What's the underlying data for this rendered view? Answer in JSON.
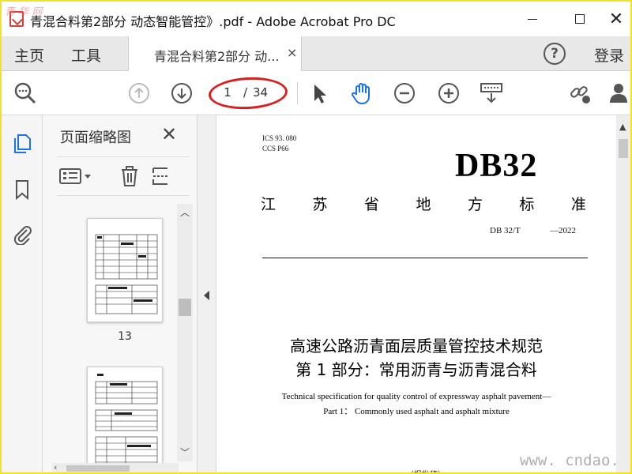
{
  "window": {
    "title": "青混合料第2部分 动态智能管控》.pdf - Adobe Acrobat Pro DC",
    "minimize_label": "",
    "close_glyph": "✕"
  },
  "tabs": {
    "home": "主页",
    "tools": "工具",
    "document_tab": "青混合料第2部分 动...",
    "close_glyph": "×",
    "help_glyph": "?",
    "login": "登录"
  },
  "toolbar": {
    "page_current": "1",
    "page_separator": "/",
    "page_total": "34",
    "icons": [
      "search-zoom-icon",
      "page-up-icon",
      "page-down-icon",
      "select-arrow-icon",
      "hand-tool-icon",
      "zoom-out-icon",
      "zoom-in-icon",
      "keyboard-icon",
      "share-link-icon",
      "add-user-icon"
    ]
  },
  "sidebar": {
    "icons": [
      "pages-icon",
      "bookmark-icon",
      "attachment-icon"
    ]
  },
  "thumbnails": {
    "title": "页面缩略图",
    "close_glyph": "✕",
    "pages": [
      {
        "label": "13"
      },
      {
        "label": ""
      }
    ]
  },
  "document": {
    "ics_line": "ICS   93. 080",
    "ccs_line": "CCS   P66",
    "db_code": "DB32",
    "standard_chars": [
      "江",
      "苏",
      "省",
      "地",
      "方",
      "标",
      "准"
    ],
    "standard_code": "DB 32/T",
    "standard_year": "—2022",
    "title_line1": "高速公路沥青面层质量管控技术规范",
    "title_line2": "第 1 部分：常用沥青与沥青混合料",
    "english_line1": "Technical specification for quality control of expressway asphalt pavement—",
    "english_line2": "Part 1：  Commonly used asphalt and asphalt mixture",
    "bottom_partial": "（报批稿）"
  },
  "watermarks": {
    "top_left": "青 华 网",
    "bottom_right": "www. cndao. com"
  },
  "colors": {
    "highlight_oval": "#d91f1f",
    "hand_tool_active": "#1a73e8",
    "frame_border": "#f2e229"
  }
}
